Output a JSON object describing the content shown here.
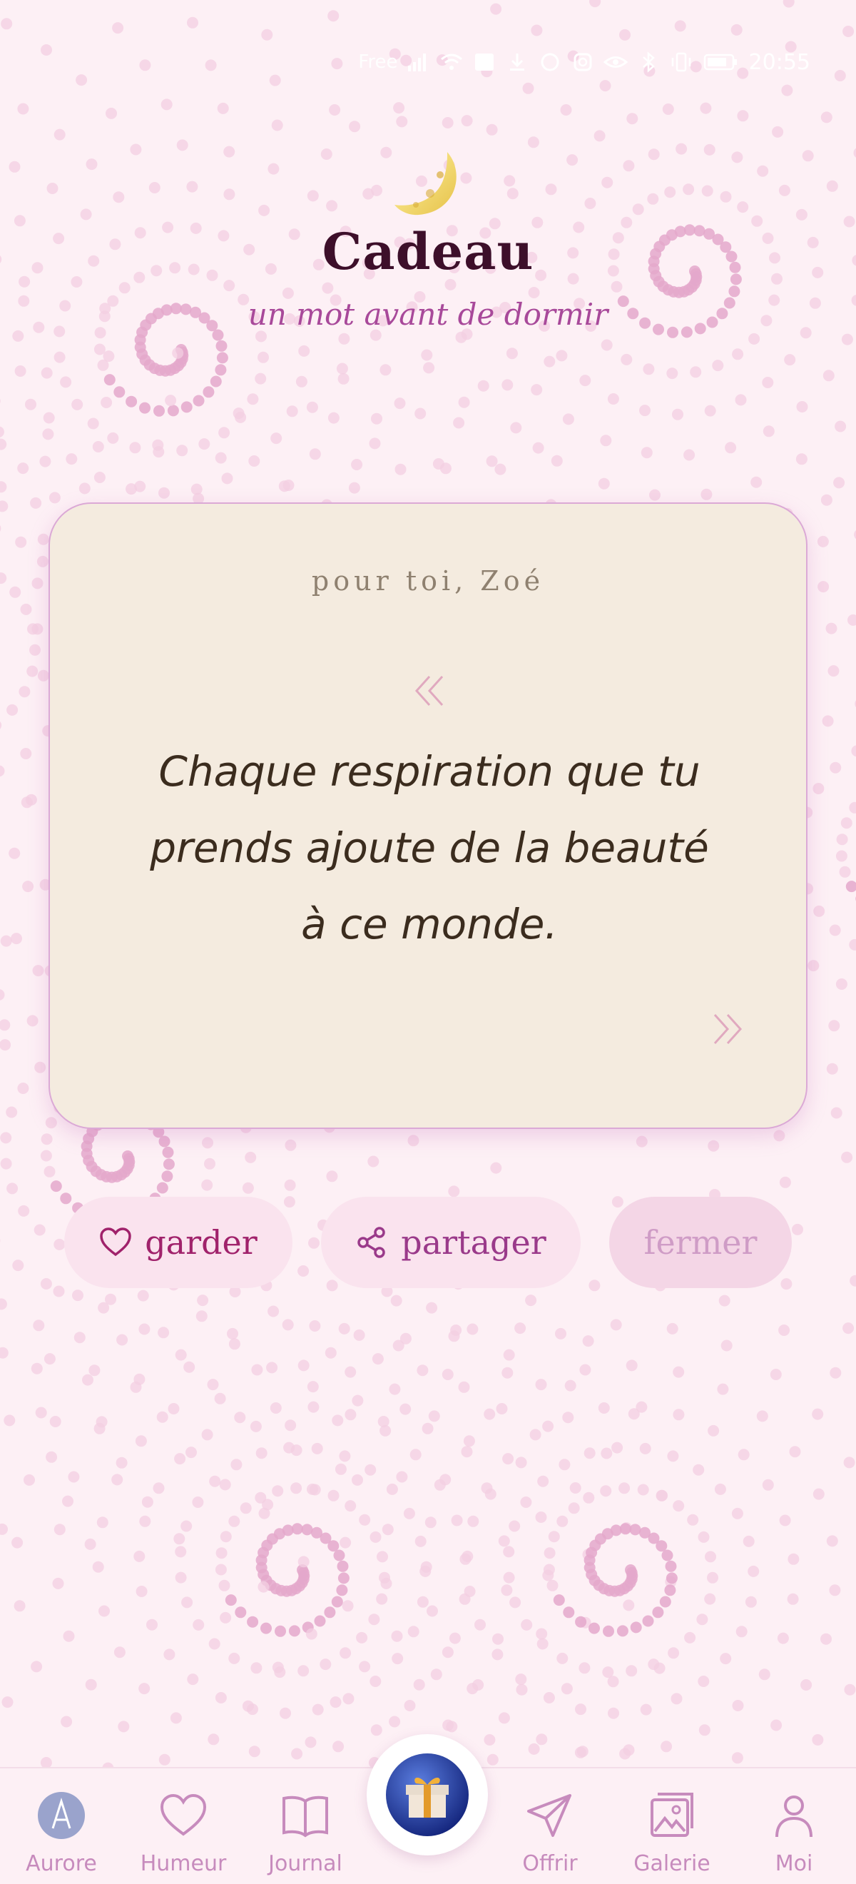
{
  "status_bar": {
    "carrier": "Free",
    "time": "20:55",
    "icons": [
      "signal-icon",
      "wifi-icon",
      "nfc-icon",
      "download-icon",
      "whatsapp-icon",
      "instagram-icon",
      "eye-icon",
      "bluetooth-icon",
      "vibrate-icon",
      "battery-icon"
    ]
  },
  "header": {
    "icon": "crescent-moon-icon",
    "title": "Cadeau",
    "subtitle": "un mot avant de dormir"
  },
  "card": {
    "recipient": "pour toi, Zoé",
    "quote_lines": [
      "Chaque respiration que tu",
      "prends ajoute de la beauté",
      "à ce monde."
    ]
  },
  "actions": {
    "keep_label": "garder",
    "share_label": "partager",
    "close_label": "fermer"
  },
  "tabbar": {
    "tabs": [
      {
        "label": "Aurore",
        "icon": "aurore-avatar-icon"
      },
      {
        "label": "Humeur",
        "icon": "heart-icon"
      },
      {
        "label": "Journal",
        "icon": "book-icon"
      },
      {
        "label": "Offrir",
        "icon": "send-icon"
      },
      {
        "label": "Galerie",
        "icon": "gallery-icon"
      },
      {
        "label": "Moi",
        "icon": "person-icon"
      }
    ],
    "center_icon": "gift-icon"
  },
  "colors": {
    "background": "#fdf0f5",
    "title": "#3d0f2a",
    "accent": "#a8499a",
    "card": "#f4ebdf",
    "tab_label": "#c78bbd"
  }
}
